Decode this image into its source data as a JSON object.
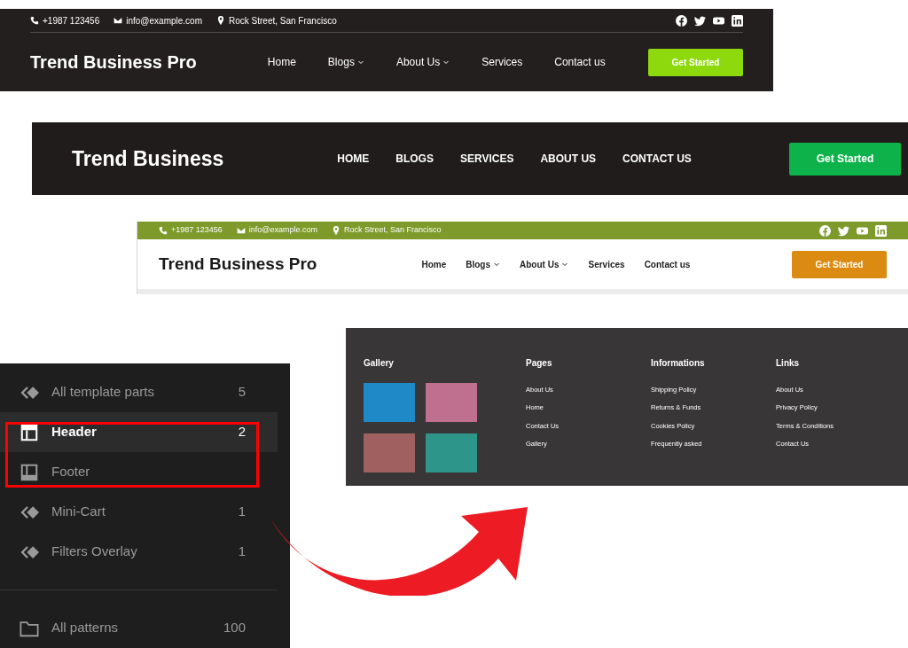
{
  "header_dark": {
    "contact": {
      "phone": "+1987 123456",
      "email": "info@example.com",
      "address": "Rock Street, San Francisco"
    },
    "logo": "Trend Business Pro",
    "nav": [
      {
        "label": "Home",
        "dropdown": false
      },
      {
        "label": "Blogs",
        "dropdown": true
      },
      {
        "label": "About Us",
        "dropdown": true
      },
      {
        "label": "Services",
        "dropdown": false
      },
      {
        "label": "Contact us",
        "dropdown": false
      }
    ],
    "button": "Get Started"
  },
  "header_simple": {
    "logo": "Trend Business",
    "nav": [
      {
        "label": "HOME",
        "dropdown": false
      },
      {
        "label": "BLOGS",
        "dropdown": false
      },
      {
        "label": "SERVICES",
        "dropdown": false
      },
      {
        "label": "ABOUT US",
        "dropdown": false
      },
      {
        "label": "CONTACT US",
        "dropdown": false
      }
    ],
    "button": "Get Started"
  },
  "header_light": {
    "contact": {
      "phone": "+1987 123456",
      "email": "info@example.com",
      "address": "Rock Street, San Francisco"
    },
    "logo": "Trend Business Pro",
    "nav": [
      {
        "label": "Home",
        "dropdown": false
      },
      {
        "label": "Blogs",
        "dropdown": true
      },
      {
        "label": "About Us",
        "dropdown": true
      },
      {
        "label": "Services",
        "dropdown": false
      },
      {
        "label": "Contact us",
        "dropdown": false
      }
    ],
    "button": "Get Started"
  },
  "footer": {
    "gallery_title": "Gallery",
    "columns": [
      {
        "title": "Pages",
        "links": [
          "About Us",
          "Home",
          "Contact Us",
          "Gallery"
        ]
      },
      {
        "title": "Informations",
        "links": [
          "Shipping Policy",
          "Returns & Funds",
          "Cookies Policy",
          "Frequently asked"
        ]
      },
      {
        "title": "Links",
        "links": [
          "About Us",
          "Privacy Policy",
          "Terms & Conditions",
          "Contact Us"
        ]
      }
    ]
  },
  "sidebar": {
    "items": [
      {
        "kind": "template",
        "label": "All template parts",
        "count": "5",
        "selected": false
      },
      {
        "kind": "header",
        "label": "Header",
        "count": "2",
        "selected": true
      },
      {
        "kind": "footer",
        "label": "Footer",
        "selected": false
      },
      {
        "kind": "template",
        "label": "Mini-Cart",
        "count": "1",
        "selected": false
      },
      {
        "kind": "template",
        "label": "Filters Overlay",
        "count": "1",
        "selected": false
      },
      {
        "kind": "folder",
        "label": "All patterns",
        "count": "100",
        "selected": false
      }
    ]
  }
}
